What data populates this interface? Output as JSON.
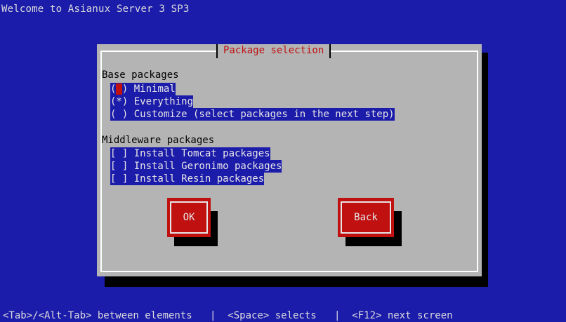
{
  "screen": {
    "welcome_text": "Welcome to Asianux Server 3 SP3",
    "help_line": "<Tab>/<Alt-Tab> between elements   |  <Space> selects   |  <F12> next screen"
  },
  "dialog": {
    "title": "Package selection",
    "base_section": {
      "label": "Base packages",
      "options": [
        {
          "marker": "( ) ",
          "label": "Minimal",
          "selected": false,
          "focused": true
        },
        {
          "marker": "(*) ",
          "label": "Everything",
          "selected": true,
          "focused": false
        },
        {
          "marker": "( ) ",
          "label": "Customize (select packages in the next step)",
          "selected": false,
          "focused": false
        }
      ]
    },
    "middleware_section": {
      "label": "Middleware packages",
      "options": [
        {
          "marker": "[ ] ",
          "label": "Install Tomcat packages",
          "checked": false
        },
        {
          "marker": "[ ] ",
          "label": "Install Geronimo packages",
          "checked": false
        },
        {
          "marker": "[ ] ",
          "label": "Install Resin packages",
          "checked": false
        }
      ]
    },
    "buttons": {
      "ok_label": "OK",
      "back_label": "Back"
    }
  },
  "colors": {
    "background": "#1c1cab",
    "dialog": "#b4b4b4",
    "accent": "#c01010",
    "highlight": "#1c1cab"
  }
}
